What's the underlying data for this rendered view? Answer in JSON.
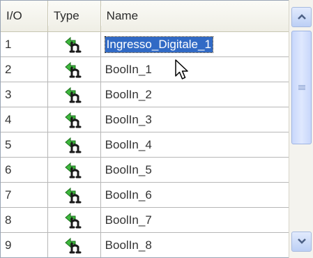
{
  "header": {
    "io": "I/O",
    "type": "Type",
    "name": "Name"
  },
  "rows": [
    {
      "io": "1",
      "name": "Ingresso_Digitale_1",
      "type_icon": "digital-input-icon"
    },
    {
      "io": "2",
      "name": "BoolIn_1",
      "type_icon": "digital-input-icon"
    },
    {
      "io": "3",
      "name": "BoolIn_2",
      "type_icon": "digital-input-icon"
    },
    {
      "io": "4",
      "name": "BoolIn_3",
      "type_icon": "digital-input-icon"
    },
    {
      "io": "5",
      "name": "BoolIn_4",
      "type_icon": "digital-input-icon"
    },
    {
      "io": "6",
      "name": "BoolIn_5",
      "type_icon": "digital-input-icon"
    },
    {
      "io": "7",
      "name": "BoolIn_6",
      "type_icon": "digital-input-icon"
    },
    {
      "io": "8",
      "name": "BoolIn_7",
      "type_icon": "digital-input-icon"
    },
    {
      "io": "9",
      "name": "BoolIn_8",
      "type_icon": "digital-input-icon"
    }
  ],
  "selection": {
    "selected_row": "1",
    "selected_text": "Ingresso_Digitale_1",
    "highlight_color": "#316ac5"
  },
  "scrollbar": {
    "up_icon": "chevron-up-icon",
    "down_icon": "chevron-down-icon",
    "thumb_grip_icon": "grip-icon",
    "accent_color": "#4d6185"
  },
  "cursor": {
    "icon": "mouse-pointer-icon"
  }
}
